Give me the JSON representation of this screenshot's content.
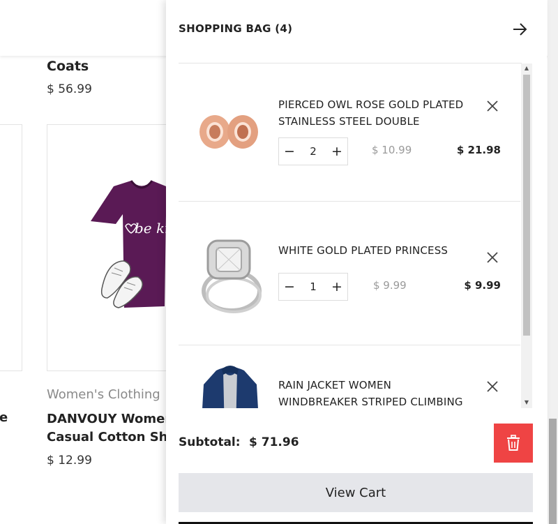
{
  "background": {
    "product_top": {
      "title": "Coats",
      "price": "$ 56.99"
    },
    "product_card": {
      "category": "Women's Clothing",
      "name_line1": "DANVOUY Women",
      "name_line2": "Casual Cotton Sh",
      "price": "$ 12.99",
      "shirt_text": "be kind"
    },
    "left_fragment": "e"
  },
  "cart": {
    "title": "SHOPPING BAG (4)",
    "close_icon": "arrow-right-icon",
    "items": [
      {
        "name": "PIERCED OWL ROSE GOLD PLATED STAINLESS STEEL DOUBLE",
        "qty": "2",
        "unit_price": "$ 10.99",
        "total": "$ 21.98",
        "image": "rose-gold-earrings"
      },
      {
        "name": "WHITE GOLD PLATED PRINCESS",
        "qty": "1",
        "unit_price": "$ 9.99",
        "total": "$ 9.99",
        "image": "diamond-ring"
      },
      {
        "name": "RAIN JACKET WOMEN WINDBREAKER STRIPED CLIMBING",
        "image": "navy-rain-jacket"
      }
    ],
    "minus_symbol": "−",
    "plus_symbol": "+",
    "subtotal_label": "Subtotal:",
    "subtotal_value": "$ 71.96",
    "view_cart_label": "View Cart",
    "trash_icon": "trash-icon",
    "colors": {
      "danger": "#ef4444",
      "button_bg": "#e5e6ea",
      "muted": "#9a9a9a"
    }
  }
}
